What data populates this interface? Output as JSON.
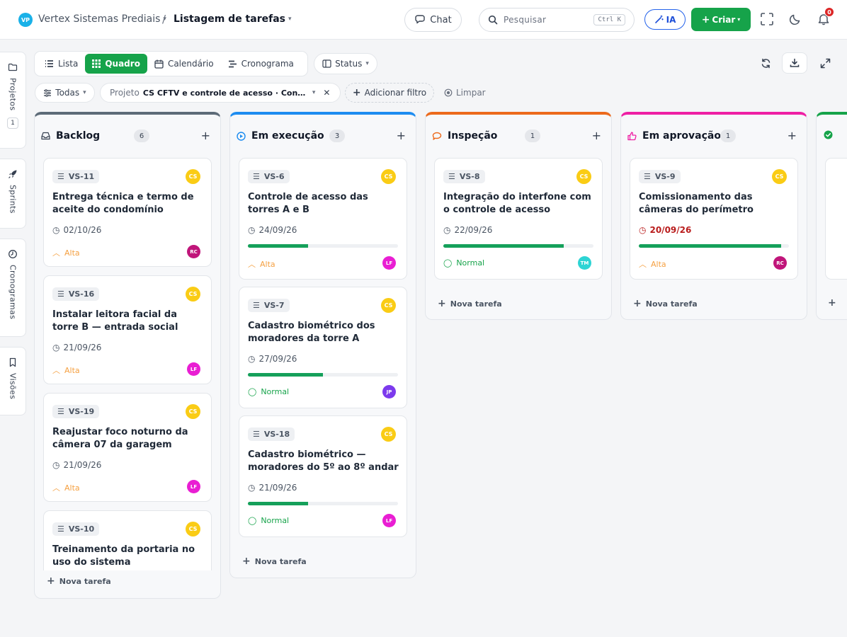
{
  "header": {
    "org_initials": "VP",
    "org_name": "Vertex Sistemas Prediais",
    "separator": "/",
    "page_title": "Listagem de tarefas",
    "chat_label": "Chat",
    "search_placeholder": "Pesquisar",
    "search_shortcut": "Ctrl K",
    "ia_label": "IA",
    "create_label": "Criar",
    "notifications_count": "0"
  },
  "sidebar": {
    "projects_label": "Projetos",
    "projects_count": "1",
    "sprints_label": "Sprints",
    "schedules_label": "Cronogramas",
    "views_label": "Visões"
  },
  "views": {
    "tabs": [
      "Lista",
      "Quadro",
      "Calendário",
      "Cronograma"
    ],
    "active": "Quadro",
    "status_label": "Status"
  },
  "filters": {
    "scope": "Todas",
    "project_key": "Projeto",
    "project_value": "CS CFTV e controle de acesso · Condomí...",
    "add_filter": "Adicionar filtro",
    "clear": "Limpar"
  },
  "board": {
    "new_task_label": "Nova tarefa",
    "colors": {
      "backlog": "#5d6b78",
      "em_execucao": "#1d8cf0",
      "inspecao": "#ec6a1c",
      "em_aprovacao": "#ee1fa4",
      "concluido": "#16a34a"
    },
    "columns": [
      {
        "title": "Backlog",
        "count": "6",
        "cards": [
          {
            "key": "VS-11",
            "owner": "CS",
            "title": "Entrega técnica e termo de aceite do condomínio",
            "date": "02/10/26",
            "priority": "Alta",
            "assignee": "RC"
          },
          {
            "key": "VS-16",
            "owner": "CS",
            "title": "Instalar leitora facial da torre B — entrada social",
            "date": "21/09/26",
            "priority": "Alta",
            "assignee": "LF"
          },
          {
            "key": "VS-19",
            "owner": "CS",
            "title": "Reajustar foco noturno da câmera 07 da garagem",
            "date": "21/09/26",
            "priority": "Alta",
            "assignee": "LF"
          },
          {
            "key": "VS-10",
            "owner": "CS",
            "title": "Treinamento da portaria no uso do sistema"
          }
        ]
      },
      {
        "title": "Em execução",
        "count": "3",
        "cards": [
          {
            "key": "VS-6",
            "owner": "CS",
            "title": "Controle de acesso das torres A e B",
            "date": "24/09/26",
            "progress": 0.4,
            "priority": "Alta",
            "assignee": "LF"
          },
          {
            "key": "VS-7",
            "owner": "CS",
            "title": "Cadastro biométrico dos moradores da torre A",
            "date": "27/09/26",
            "progress": 0.5,
            "priority": "Normal",
            "assignee": "JP"
          },
          {
            "key": "VS-18",
            "owner": "CS",
            "title": "Cadastro biométrico — moradores do 5º ao 8º andar",
            "date": "21/09/26",
            "progress": 0.4,
            "priority": "Normal",
            "assignee": "LF"
          }
        ]
      },
      {
        "title": "Inspeção",
        "count": "1",
        "cards": [
          {
            "key": "VS-8",
            "owner": "CS",
            "title": "Integração do interfone com o controle de acesso",
            "date": "22/09/26",
            "progress": 0.8,
            "priority": "Normal",
            "assignee": "TM"
          }
        ]
      },
      {
        "title": "Em aprovação",
        "count": "1",
        "cards": [
          {
            "key": "VS-9",
            "owner": "CS",
            "title": "Comissionamento das câmeras do perímetro",
            "date": "20/09/26",
            "overdue": true,
            "progress": 0.95,
            "priority": "Alta",
            "assignee": "RC"
          }
        ]
      }
    ]
  }
}
